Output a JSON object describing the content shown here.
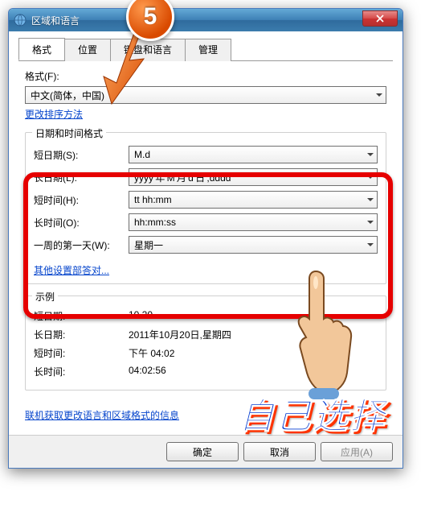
{
  "window": {
    "title": "区域和语言"
  },
  "tabs": [
    "格式",
    "位置",
    "键盘和语言",
    "管理"
  ],
  "format": {
    "label": "格式(F):",
    "value": "中文(简体，中国)",
    "change_sort_link": "更改排序方法"
  },
  "datetime_group": {
    "legend": "日期和时间格式",
    "rows": [
      {
        "label": "短日期(S):",
        "value": "M.d"
      },
      {
        "label": "长日期(L):",
        "value": "yyyy'年'M'月'd'日',dddd"
      },
      {
        "label": "短时间(H):",
        "value": "tt hh:mm"
      },
      {
        "label": "长时间(O):",
        "value": "hh:mm:ss"
      },
      {
        "label": "一周的第一天(W):",
        "value": "星期一"
      }
    ],
    "more_settings_link": "其他设置部答对..."
  },
  "example_group": {
    "legend": "示例",
    "rows": [
      {
        "label": "短日期:",
        "value": "10.20"
      },
      {
        "label": "长日期:",
        "value": "2011年10月20日,星期四"
      },
      {
        "label": "短时间:",
        "value": "下午 04:02"
      },
      {
        "label": "长时间:",
        "value": "04:02:56"
      }
    ]
  },
  "online_link": "联机获取更改语言和区域格式的信息",
  "buttons": {
    "ok": "确定",
    "cancel": "取消",
    "apply": "应用(A)"
  },
  "overlay": {
    "step": "5",
    "annotation": "自己选择"
  }
}
